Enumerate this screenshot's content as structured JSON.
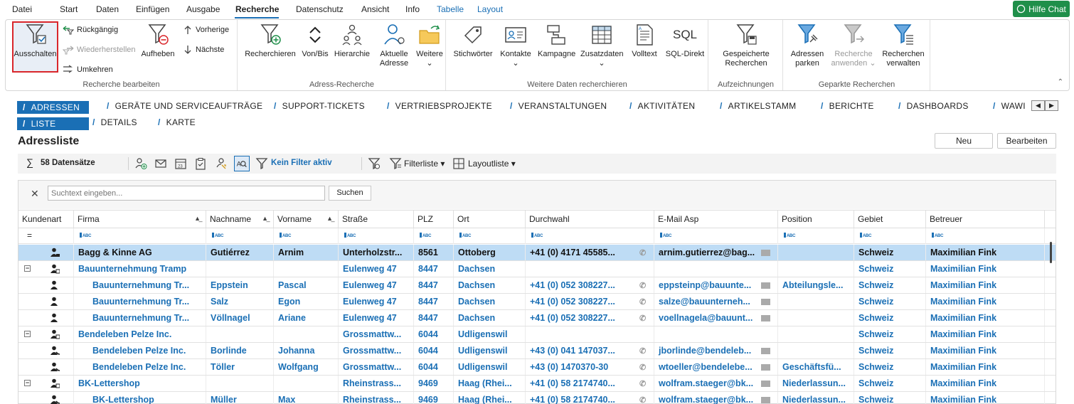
{
  "menu": {
    "items": [
      "Datei",
      "Start",
      "Daten",
      "Einfügen",
      "Ausgabe",
      "Recherche",
      "Datenschutz",
      "Ansicht",
      "Info",
      "Tabelle",
      "Layout"
    ],
    "help_button": "Hilfe Chat"
  },
  "ribbon": {
    "groups": {
      "recherche_bearbeiten": "Recherche bearbeiten",
      "adress_recherche": "Adress-Recherche",
      "weitere_daten": "Weitere Daten recherchieren",
      "aufzeichnungen": "Aufzeichnungen",
      "geparkte": "Geparkte Recherchen"
    },
    "ausschalten": "Ausschalten",
    "rueckgaengig": "Rückgängig",
    "wiederherstellen": "Wiederherstellen",
    "umkehren": "Umkehren",
    "aufheben": "Aufheben",
    "vorherige": "Vorherige",
    "naechste": "Nächste",
    "recherchieren": "Recherchieren",
    "von_bis": "Von/Bis",
    "hierarchie": "Hierarchie",
    "aktuelle_adresse_1": "Aktuelle",
    "aktuelle_adresse_2": "Adresse",
    "weitere": "Weitere",
    "stichwoerter": "Stichwörter",
    "kontakte": "Kontakte",
    "kampagne": "Kampagne",
    "zusatzdaten": "Zusatzdaten",
    "volltext": "Volltext",
    "sql_direkt": "SQL-Direkt",
    "sql_icon_text": "SQL",
    "gespeicherte_1": "Gespeicherte",
    "gespeicherte_2": "Recherchen",
    "adressen_parken_1": "Adressen",
    "adressen_parken_2": "parken",
    "recherche_anwenden_1": "Recherche",
    "recherche_anwenden_2": "anwenden",
    "recherchen_verwalten_1": "Recherchen",
    "recherchen_verwalten_2": "verwalten"
  },
  "module_tabs": [
    "ADRESSEN",
    "GERÄTE UND SERVICEAUFTRÄGE",
    "SUPPORT-TICKETS",
    "VERTRIEBSPROJEKTE",
    "VERANSTALTUNGEN",
    "AKTIVITÄTEN",
    "ARTIKELSTAMM",
    "BERICHTE",
    "DASHBOARDS",
    "WAWI"
  ],
  "sub_tabs": [
    "LISTE",
    "DETAILS",
    "KARTE"
  ],
  "page": {
    "title": "Adressliste",
    "new_button": "Neu",
    "edit_button": "Bearbeiten"
  },
  "toolbar": {
    "record_count": "58 Datensätze",
    "filter_status": "Kein Filter aktiv",
    "filterliste": "Filterliste",
    "layoutliste": "Layoutliste"
  },
  "search": {
    "placeholder": "Suchtext eingeben...",
    "button": "Suchen"
  },
  "columns": [
    "Kundenart",
    "Firma",
    "Nachname",
    "Vorname",
    "Straße",
    "PLZ",
    "Ort",
    "Durchwahl",
    "E-Mail Asp",
    "Position",
    "Gebiet",
    "Betreuer"
  ],
  "rows": [
    {
      "expander": "",
      "firma": "Bagg & Kinne AG",
      "nachname": "Gutiérrez",
      "vorname": "Arnim",
      "strasse": "Unterholzstr...",
      "plz": "8561",
      "ort": "Ottoberg",
      "durchwahl": "+41 (0) 4171 45585...",
      "email": "arnim.gutierrez@bag...",
      "position": "",
      "gebiet": "Schweiz",
      "betreuer": "Maximilian Fink",
      "indent": false,
      "icon": "person-card-icon"
    },
    {
      "expander": "−",
      "firma": "Bauunternehmung Tramp",
      "nachname": "",
      "vorname": "",
      "strasse": "Eulenweg 47",
      "plz": "8447",
      "ort": "Dachsen",
      "durchwahl": "",
      "email": "",
      "position": "",
      "gebiet": "Schweiz",
      "betreuer": "Maximilian Fink",
      "indent": false,
      "icon": "company-icon"
    },
    {
      "expander": "",
      "firma": "Bauunternehmung Tr...",
      "nachname": "Eppstein",
      "vorname": "Pascal",
      "strasse": "Eulenweg 47",
      "plz": "8447",
      "ort": "Dachsen",
      "durchwahl": "+41 (0) 052 308227...",
      "email": "eppsteinp@bauunte...",
      "position": "Abteilungsle...",
      "gebiet": "Schweiz",
      "betreuer": "Maximilian Fink",
      "indent": true,
      "icon": "contact-person-icon"
    },
    {
      "expander": "",
      "firma": "Bauunternehmung Tr...",
      "nachname": "Salz",
      "vorname": "Egon",
      "strasse": "Eulenweg 47",
      "plz": "8447",
      "ort": "Dachsen",
      "durchwahl": "+41 (0) 052 308227...",
      "email": "salze@bauunterneh...",
      "position": "",
      "gebiet": "Schweiz",
      "betreuer": "Maximilian Fink",
      "indent": true,
      "icon": "contact-person-icon"
    },
    {
      "expander": "",
      "firma": "Bauunternehmung Tr...",
      "nachname": "Völlnagel",
      "vorname": "Ariane",
      "strasse": "Eulenweg 47",
      "plz": "8447",
      "ort": "Dachsen",
      "durchwahl": "+41 (0) 052 308227...",
      "email": "voellnagela@bauunt...",
      "position": "",
      "gebiet": "Schweiz",
      "betreuer": "Maximilian Fink",
      "indent": true,
      "icon": "contact-person-icon"
    },
    {
      "expander": "−",
      "firma": "Bendeleben Pelze Inc.",
      "nachname": "",
      "vorname": "",
      "strasse": "Grossmattw...",
      "plz": "6044",
      "ort": "Udligenswil",
      "durchwahl": "",
      "email": "",
      "position": "",
      "gebiet": "Schweiz",
      "betreuer": "Maximilian Fink",
      "indent": false,
      "icon": "company-icon"
    },
    {
      "expander": "",
      "firma": "Bendeleben Pelze Inc.",
      "nachname": "Borlinde",
      "vorname": "Johanna",
      "strasse": "Grossmattw...",
      "plz": "6044",
      "ort": "Udligenswil",
      "durchwahl": "+43 (0) 041 147037...",
      "email": "jborlinde@bendeleb...",
      "position": "",
      "gebiet": "Schweiz",
      "betreuer": "Maximilian Fink",
      "indent": true,
      "icon": "phone-person-icon"
    },
    {
      "expander": "",
      "firma": "Bendeleben Pelze Inc.",
      "nachname": "Töller",
      "vorname": "Wolfgang",
      "strasse": "Grossmattw...",
      "plz": "6044",
      "ort": "Udligenswil",
      "durchwahl": "+43 (0) 1470370-30",
      "email": "wtoeller@bendelebe...",
      "position": "Geschäftsfü...",
      "gebiet": "Schweiz",
      "betreuer": "Maximilian Fink",
      "indent": true,
      "icon": "phone-person-icon"
    },
    {
      "expander": "−",
      "firma": "BK-Lettershop",
      "nachname": "",
      "vorname": "",
      "strasse": "Rheinstrass...",
      "plz": "9469",
      "ort": "Haag (Rhei...",
      "durchwahl": "+41 (0) 58 2174740...",
      "email": "wolfram.staeger@bk...",
      "position": "Niederlassun...",
      "gebiet": "Schweiz",
      "betreuer": "Maximilian Fink",
      "indent": false,
      "icon": "company-icon"
    },
    {
      "expander": "",
      "firma": "BK-Lettershop",
      "nachname": "Müller",
      "vorname": "Max",
      "strasse": "Rheinstrass...",
      "plz": "9469",
      "ort": "Haag (Rhei...",
      "durchwahl": "+41 (0) 58 2174740...",
      "email": "wolfram.staeger@bk...",
      "position": "Niederlassun...",
      "gebiet": "Schweiz",
      "betreuer": "Maximilian Fink",
      "indent": true,
      "icon": "phone-person-icon"
    }
  ],
  "colors": {
    "accent": "#1a6fb5",
    "selected_row": "#bedcf5",
    "help_green": "#1f8f4a",
    "highlight_red": "#d9262b"
  }
}
